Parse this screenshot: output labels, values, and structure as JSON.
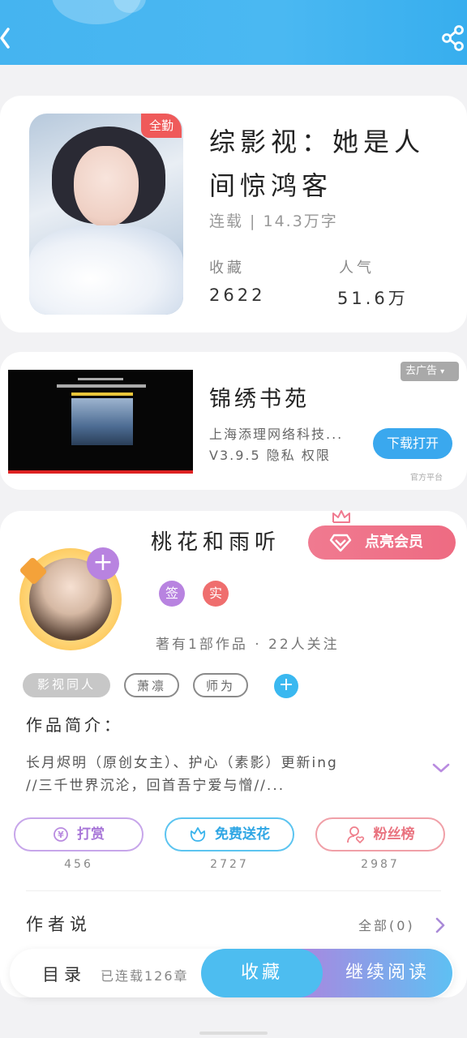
{
  "header": {
    "back_icon": "back-arrow-icon",
    "share_icon": "share-icon"
  },
  "book": {
    "badge": "全勤",
    "title_line1": "综影视：她是人",
    "title_line2": "间惊鸿客",
    "status": "连载 | 14.3万字",
    "stats": [
      {
        "label": "收藏",
        "value": "2622"
      },
      {
        "label": "人气",
        "value": "51.6万"
      }
    ]
  },
  "ad": {
    "close_label": "去广告",
    "title": "锦绣书苑",
    "company": "上海添理网络科技...",
    "meta": "V3.9.5 隐私 权限",
    "download_label": "下载打开",
    "source": "官方平台"
  },
  "author": {
    "name": "桃花和雨听",
    "vip_label": "点亮会员",
    "tags": [
      "签",
      "实"
    ],
    "stats": "著有1部作品 · 22人关注",
    "chips": [
      "影视同人",
      "萧凛",
      "师为"
    ],
    "intro_heading": "作品简介：",
    "intro_line1": "长月烬明（原创女主）、护心（素影）更新ing",
    "intro_line2": "//三千世界沉沦，回首吾宁爱与憎//...",
    "actions": [
      {
        "label": "打赏",
        "count": "456",
        "color": "#b98be0"
      },
      {
        "label": "免费送花",
        "count": "2727",
        "color": "#3ab4ec"
      },
      {
        "label": "粉丝榜",
        "count": "2987",
        "color": "#ef7f8c"
      }
    ],
    "says_label": "作者说",
    "says_all": "全部(0)"
  },
  "bottom_bar": {
    "toc_label": "目录",
    "toc_status": "已连载126章",
    "collect_label": "收藏",
    "read_label": "继续阅读"
  }
}
